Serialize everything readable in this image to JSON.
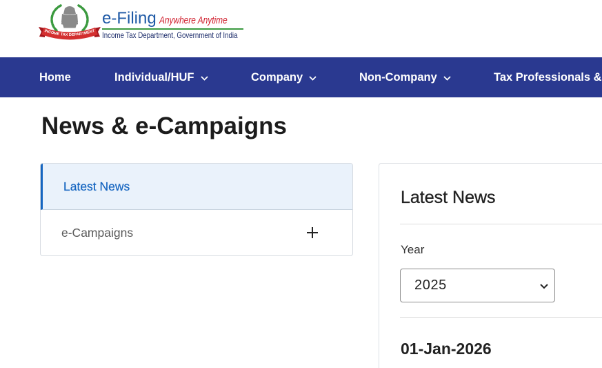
{
  "header": {
    "logo": {
      "brand": "e-Filing",
      "tagline": "Anywhere Anytime",
      "subtitle": "Income Tax Department, Government of India",
      "ribbon_text": "INCOME TAX DEPARTMENT"
    }
  },
  "nav": {
    "items": [
      {
        "label": "Home",
        "has_dropdown": false
      },
      {
        "label": "Individual/HUF",
        "has_dropdown": true
      },
      {
        "label": "Company",
        "has_dropdown": true
      },
      {
        "label": "Non-Company",
        "has_dropdown": true
      },
      {
        "label": "Tax Professionals &",
        "has_dropdown": false
      }
    ]
  },
  "page": {
    "title": "News & e-Campaigns"
  },
  "sidebar": {
    "items": [
      {
        "label": "Latest News",
        "active": true
      },
      {
        "label": "e-Campaigns",
        "active": false,
        "toggle_icon": "plus-icon"
      }
    ]
  },
  "content": {
    "heading": "Latest News",
    "year_filter": {
      "label": "Year",
      "selected": "2025",
      "icon": "chevron-down-icon"
    },
    "entries": [
      {
        "date": "01-Jan-2026"
      }
    ]
  },
  "colors": {
    "nav_background": "#2a3990",
    "accent": "#1565c0",
    "active_background": "#eaf2fb",
    "brand_blue": "#1f5aa6",
    "brand_red": "#d0202e",
    "brand_green": "#3b9a3f"
  }
}
